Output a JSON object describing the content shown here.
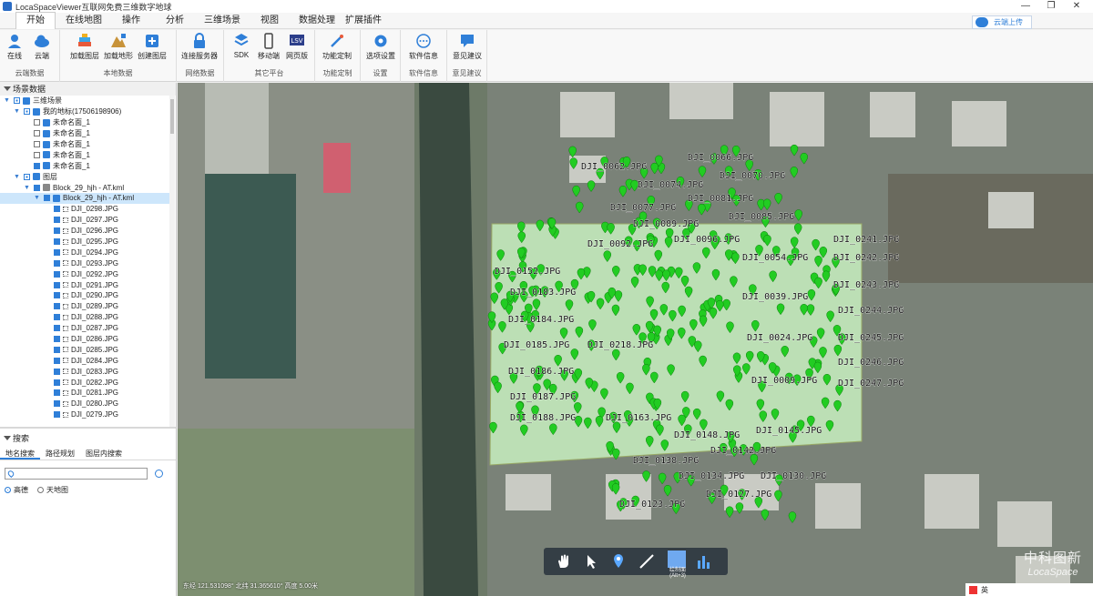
{
  "titlebar": {
    "title": "LocaSpaceViewer互联网免费三维数字地球",
    "minimize": "—",
    "maximize": "❐",
    "close": "✕"
  },
  "menu": {
    "tabs": [
      "开始",
      "在线地图",
      "操作",
      "分析",
      "三维场景",
      "视图",
      "数据处理",
      "扩展插件"
    ],
    "active": "开始",
    "cloud_upload": "云端上传"
  },
  "ribbon": {
    "groups": [
      {
        "name": "云端数据",
        "buttons": [
          "在线",
          "云端"
        ]
      },
      {
        "name": "本地数据",
        "buttons": [
          "加载图层",
          "加载地形",
          "创建图层"
        ]
      },
      {
        "name": "网络数据",
        "buttons": [
          "连接服务器"
        ]
      },
      {
        "name": "其它平台",
        "buttons": [
          "SDK",
          "移动端",
          "网页版"
        ]
      },
      {
        "name": "功能定制",
        "buttons": [
          "功能定制"
        ]
      },
      {
        "name": "设置",
        "buttons": [
          "选项设置"
        ]
      },
      {
        "name": "软件信息",
        "buttons": [
          "软件信息"
        ]
      },
      {
        "name": "意见建议",
        "buttons": [
          "意见建议"
        ]
      }
    ]
  },
  "left_panel": {
    "scene_header": "场景数据",
    "tree": [
      {
        "label": "三维场景",
        "level": 0,
        "check": "part",
        "icon": "globe-icon",
        "expand": "−"
      },
      {
        "label": "我的地标(17506198906)",
        "level": 1,
        "check": "part",
        "icon": "pin-icon",
        "expand": "−"
      },
      {
        "label": "未命名面_1",
        "level": 2,
        "check": "off",
        "icon": "polygon-icon"
      },
      {
        "label": "未命名面_1",
        "level": 2,
        "check": "off",
        "icon": "polygon-icon"
      },
      {
        "label": "未命名面_1",
        "level": 2,
        "check": "off",
        "icon": "polygon-icon"
      },
      {
        "label": "未命名面_1",
        "level": 2,
        "check": "off",
        "icon": "polygon-icon"
      },
      {
        "label": "未命名面_1",
        "level": 2,
        "check": "on",
        "icon": "polygon-icon"
      },
      {
        "label": "图层",
        "level": 1,
        "check": "part",
        "icon": "layers-icon",
        "expand": "−"
      },
      {
        "label": "Block_29_hjh - AT.kml",
        "level": 2,
        "check": "on",
        "icon": "file-icon",
        "expand": "−"
      },
      {
        "label": "Block_29_hjh - AT.kml",
        "level": 3,
        "check": "on",
        "icon": "folder-icon",
        "expand": "−",
        "selected": true
      },
      {
        "label": "DJI_0298.JPG",
        "level": 4,
        "check": "on",
        "icon": "point-icon"
      },
      {
        "label": "DJI_0297.JPG",
        "level": 4,
        "check": "on",
        "icon": "point-icon"
      },
      {
        "label": "DJI_0296.JPG",
        "level": 4,
        "check": "on",
        "icon": "point-icon"
      },
      {
        "label": "DJI_0295.JPG",
        "level": 4,
        "check": "on",
        "icon": "point-icon"
      },
      {
        "label": "DJI_0294.JPG",
        "level": 4,
        "check": "on",
        "icon": "point-icon"
      },
      {
        "label": "DJI_0293.JPG",
        "level": 4,
        "check": "on",
        "icon": "point-icon"
      },
      {
        "label": "DJI_0292.JPG",
        "level": 4,
        "check": "on",
        "icon": "point-icon"
      },
      {
        "label": "DJI_0291.JPG",
        "level": 4,
        "check": "on",
        "icon": "point-icon"
      },
      {
        "label": "DJI_0290.JPG",
        "level": 4,
        "check": "on",
        "icon": "point-icon"
      },
      {
        "label": "DJI_0289.JPG",
        "level": 4,
        "check": "on",
        "icon": "point-icon"
      },
      {
        "label": "DJI_0288.JPG",
        "level": 4,
        "check": "on",
        "icon": "point-icon"
      },
      {
        "label": "DJI_0287.JPG",
        "level": 4,
        "check": "on",
        "icon": "point-icon"
      },
      {
        "label": "DJI_0286.JPG",
        "level": 4,
        "check": "on",
        "icon": "point-icon"
      },
      {
        "label": "DJI_0285.JPG",
        "level": 4,
        "check": "on",
        "icon": "point-icon"
      },
      {
        "label": "DJI_0284.JPG",
        "level": 4,
        "check": "on",
        "icon": "point-icon"
      },
      {
        "label": "DJI_0283.JPG",
        "level": 4,
        "check": "on",
        "icon": "point-icon"
      },
      {
        "label": "DJI_0282.JPG",
        "level": 4,
        "check": "on",
        "icon": "point-icon"
      },
      {
        "label": "DJI_0281.JPG",
        "level": 4,
        "check": "on",
        "icon": "point-icon"
      },
      {
        "label": "DJI_0280.JPG",
        "level": 4,
        "check": "on",
        "icon": "point-icon"
      },
      {
        "label": "DJI_0279.JPG",
        "level": 4,
        "check": "on",
        "icon": "point-icon"
      }
    ],
    "search_header": "搜索",
    "search_tabs": [
      "地名搜索",
      "路径规划",
      "图层内搜索"
    ],
    "search_placeholder": "",
    "radio_options": [
      {
        "label": "高德",
        "selected": true
      },
      {
        "label": "天地图",
        "selected": false
      }
    ]
  },
  "map": {
    "coords_text": "东经 121.531098°  北纬 31.365610°  高度 5.00米",
    "watermark_cn": "中科图新",
    "watermark_en": "LocaSpace",
    "polygon_fill": "#c8f0c0",
    "marker_color": "#22cc22",
    "labels": [
      "DJI_0066.JPG",
      "DJI_0062.JPG",
      "DJI_0070.JPG",
      "DJI_0074.JPG",
      "DJI_0081.JPG",
      "DJI_0077.JPG",
      "DJI_0085.JPG",
      "DJI_0089.JPG",
      "DJI_0092.JPG",
      "DJI_0096.JPG",
      "DJI_0241.JPG",
      "DJI_0242.JPG",
      "DJI_0054.JPG",
      "DJI_0152.JPG",
      "DJI_0243.JPG",
      "DJI_0183.JPG",
      "DJI_0039.JPG",
      "DJI_0244.JPG",
      "DJI_0184.JPG",
      "DJI_0185.JPG",
      "DJI_0218.JPG",
      "DJI_0024.JPG",
      "DJI_0245.JPG",
      "DJI_0186.JPG",
      "DJI_0246.JPG",
      "DJI_0009.JPG",
      "DJI_0187.JPG",
      "DJI_0247.JPG",
      "DJI_0188.JPG",
      "DJI_0163.JPG",
      "DJI_0148.JPG",
      "DJI_0145.JPG",
      "DJI_0142.JPG",
      "DJI_0138.JPG",
      "DJI_0134.JPG",
      "DJI_0130.JPG",
      "DJI_0127.JPG",
      "DJI_0123.JPG"
    ],
    "toolbar": {
      "tools": [
        "hand-icon",
        "pointer-icon",
        "pin-icon",
        "line-icon",
        "polygon-draw-icon",
        "chart-icon"
      ],
      "selected_label": "绘制面",
      "selected_shortcut": "(Alt+3)"
    }
  },
  "taskbar": {
    "ime": "英"
  }
}
